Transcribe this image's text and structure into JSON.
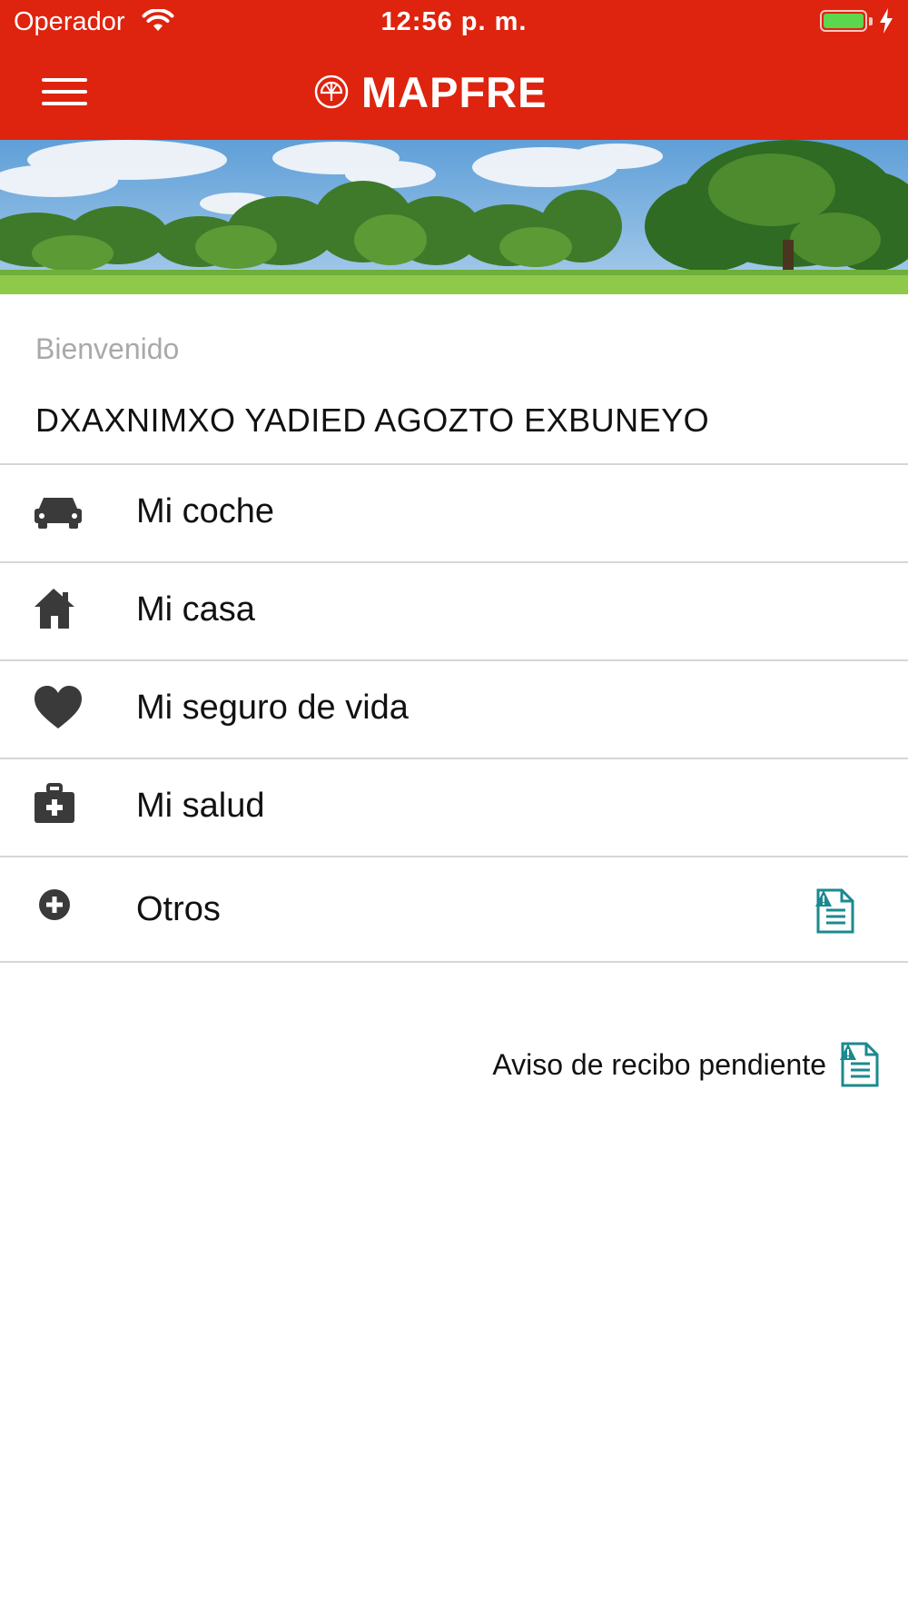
{
  "status_bar": {
    "carrier": "Operador",
    "time": "12:56 p. m.",
    "battery_percent": 100
  },
  "header": {
    "brand": "MAPFRE",
    "menu_icon": "hamburger-menu-icon",
    "logo_icon": "mapfre-logo-icon"
  },
  "welcome": {
    "greeting": "Bienvenido",
    "user_name": "DXAXNIMXO YADIED AGOZTO EXBUNEYO"
  },
  "menu_items": [
    {
      "label": "Mi coche",
      "icon": "car-icon"
    },
    {
      "label": "Mi casa",
      "icon": "house-icon"
    },
    {
      "label": "Mi seguro de vida",
      "icon": "heart-icon"
    },
    {
      "label": "Mi salud",
      "icon": "medical-kit-icon"
    },
    {
      "label": "Otros",
      "icon": "plus-circle-icon",
      "badge_icon": "pending-receipt-icon"
    }
  ],
  "notice": {
    "label": "Aviso de recibo pendiente",
    "icon": "pending-receipt-icon"
  },
  "colors": {
    "brand_red": "#de230e",
    "icon_gray": "#3a3a3a",
    "teal": "#1b8a8f",
    "divider": "#d6d6d6",
    "muted_text": "#a9a9a9"
  }
}
